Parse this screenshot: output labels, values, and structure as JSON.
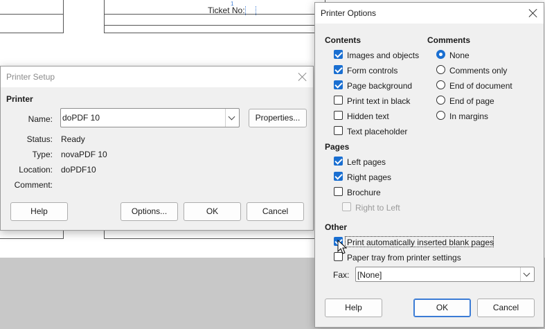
{
  "background_document": {
    "ticket_label": "Ticket No:",
    "field_marker": "1"
  },
  "printer_setup": {
    "title": "Printer Setup",
    "section_printer": "Printer",
    "name_label": "Name:",
    "name_value": "doPDF 10",
    "properties_button": "Properties...",
    "status_label": "Status:",
    "status_value": "Ready",
    "type_label": "Type:",
    "type_value": "novaPDF 10",
    "location_label": "Location:",
    "location_value": "doPDF10",
    "comment_label": "Comment:",
    "comment_value": "",
    "help_button": "Help",
    "options_button": "Options...",
    "ok_button": "OK",
    "cancel_button": "Cancel"
  },
  "printer_options": {
    "title": "Printer Options",
    "contents": {
      "heading": "Contents",
      "items": [
        {
          "label": "Images and objects",
          "checked": true
        },
        {
          "label": "Form controls",
          "checked": true
        },
        {
          "label": "Page background",
          "checked": true
        },
        {
          "label": "Print text in black",
          "checked": false
        },
        {
          "label": "Hidden text",
          "checked": false
        },
        {
          "label": "Text placeholder",
          "checked": false
        }
      ]
    },
    "comments": {
      "heading": "Comments",
      "options": [
        {
          "label": "None",
          "selected": true
        },
        {
          "label": "Comments only",
          "selected": false
        },
        {
          "label": "End of document",
          "selected": false
        },
        {
          "label": "End of page",
          "selected": false
        },
        {
          "label": "In margins",
          "selected": false
        }
      ]
    },
    "pages": {
      "heading": "Pages",
      "items": [
        {
          "label": "Left pages",
          "checked": true
        },
        {
          "label": "Right pages",
          "checked": true
        },
        {
          "label": "Brochure",
          "checked": false
        },
        {
          "label": "Right to Left",
          "checked": false,
          "disabled": true
        }
      ]
    },
    "other": {
      "heading": "Other",
      "items": [
        {
          "label": "Print automatically inserted blank pages",
          "checked": true
        },
        {
          "label": "Paper tray from printer settings",
          "checked": false
        }
      ],
      "fax_label": "Fax:",
      "fax_value": "[None]"
    },
    "help_button": "Help",
    "ok_button": "OK",
    "cancel_button": "Cancel"
  },
  "colors": {
    "accent": "#1a6fd1",
    "dialog_bg": "#f0f0f0"
  }
}
